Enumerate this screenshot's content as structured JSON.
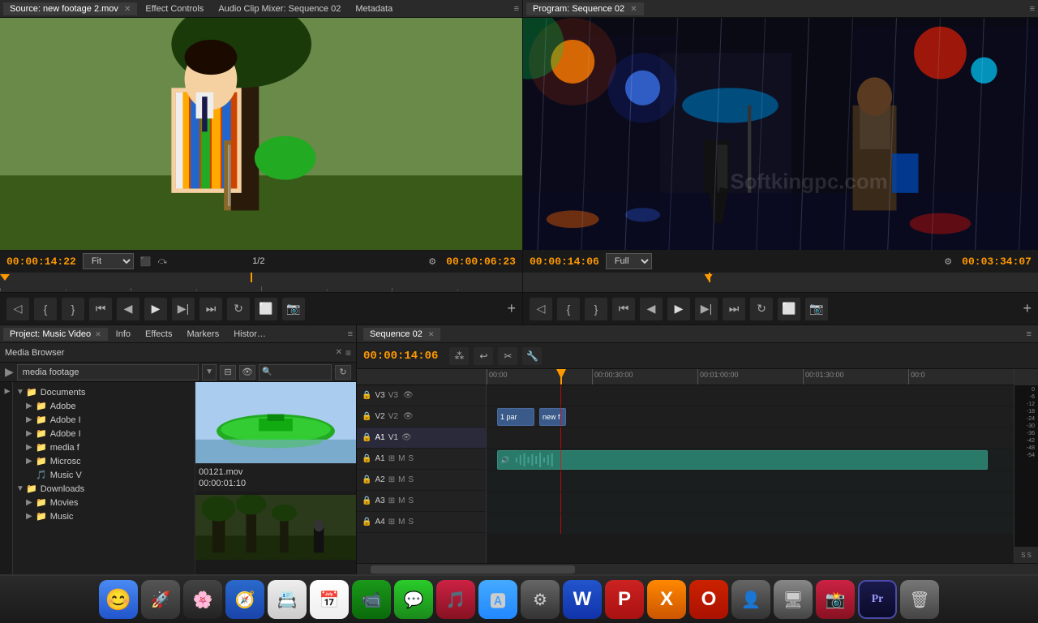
{
  "app": {
    "title": "Adobe Premiere Pro"
  },
  "source_panel": {
    "tabs": [
      {
        "label": "Source: new footage 2.mov",
        "active": true,
        "closeable": true
      },
      {
        "label": "Effect Controls",
        "active": false
      },
      {
        "label": "Audio Clip Mixer: Sequence 02",
        "active": false
      },
      {
        "label": "Metadata",
        "active": false
      }
    ],
    "timecode": "00:00:14:22",
    "fit_label": "Fit",
    "fraction": "1/2",
    "duration": "00:00:06:23"
  },
  "program_panel": {
    "tabs": [
      {
        "label": "Program: Sequence 02",
        "active": true,
        "closeable": true
      }
    ],
    "timecode": "00:00:14:06",
    "fit_label": "Full",
    "duration": "00:03:34:07"
  },
  "project_panel": {
    "tabs": [
      {
        "label": "Project: Music Video",
        "active": true,
        "closeable": true
      },
      {
        "label": "Info",
        "active": false
      },
      {
        "label": "Effects",
        "active": false
      },
      {
        "label": "Markers",
        "active": false
      },
      {
        "label": "History",
        "active": false
      }
    ]
  },
  "media_browser": {
    "label": "Media Browser",
    "path": "media footage",
    "tree_items": [
      {
        "label": "Documents",
        "icon": "folder",
        "depth": 0,
        "expanded": true
      },
      {
        "label": "Adobe",
        "icon": "folder",
        "depth": 1
      },
      {
        "label": "Adobe I",
        "icon": "folder",
        "depth": 1
      },
      {
        "label": "Adobe I",
        "icon": "folder",
        "depth": 1
      },
      {
        "label": "media f",
        "icon": "folder",
        "depth": 1
      },
      {
        "label": "Microsc",
        "icon": "folder",
        "depth": 1
      },
      {
        "label": "Music V",
        "icon": "music",
        "depth": 1
      },
      {
        "label": "Downloads",
        "icon": "folder",
        "depth": 0,
        "expanded": true
      },
      {
        "label": "Movies",
        "icon": "folder",
        "depth": 1
      },
      {
        "label": "Music",
        "icon": "folder",
        "depth": 1
      }
    ],
    "preview": {
      "filename": "00121.mov",
      "duration": "00:00:01:10"
    }
  },
  "timeline": {
    "sequence_tab": "Sequence 02",
    "timecode": "00:00:14:06",
    "ruler_marks": [
      "00:00",
      "00:00:30:00",
      "00:01:00:00",
      "00:01:30:00",
      "00:0"
    ],
    "tracks": [
      {
        "name": "V3",
        "type": "video"
      },
      {
        "name": "V2",
        "type": "video",
        "clips": [
          {
            "label": "1 par",
            "start": 2,
            "width": 8
          },
          {
            "label": "new f",
            "start": 10,
            "width": 6
          }
        ]
      },
      {
        "name": "V1",
        "type": "video"
      },
      {
        "name": "A1",
        "type": "audio",
        "clips": [
          {
            "label": "",
            "start": 2,
            "width": 190
          }
        ]
      },
      {
        "name": "A2",
        "type": "audio"
      },
      {
        "name": "A3",
        "type": "audio"
      },
      {
        "name": "A4",
        "type": "audio"
      }
    ],
    "playhead_position": "14%",
    "buttons": {
      "snap": "⁂",
      "ripple": "⟳",
      "razor": "✂",
      "wrench": "🔧"
    }
  },
  "dock": {
    "icons": [
      {
        "name": "finder",
        "emoji": "😊",
        "color": "#4a8af4"
      },
      {
        "name": "launchpad",
        "emoji": "🚀",
        "color": "#555"
      },
      {
        "name": "photos",
        "emoji": "🖼",
        "color": "#888"
      },
      {
        "name": "safari",
        "emoji": "🧭",
        "color": "#555"
      },
      {
        "name": "contacts",
        "emoji": "📇",
        "color": "#555"
      },
      {
        "name": "calendar",
        "emoji": "📅",
        "color": "#f44"
      },
      {
        "name": "facetime",
        "emoji": "📹",
        "color": "#2a2"
      },
      {
        "name": "messages",
        "emoji": "💬",
        "color": "#2a2"
      },
      {
        "name": "music",
        "emoji": "🎵",
        "color": "#f55"
      },
      {
        "name": "appstore",
        "emoji": "🅰",
        "color": "#4af"
      },
      {
        "name": "activity",
        "emoji": "⚙",
        "color": "#888"
      },
      {
        "name": "word",
        "emoji": "W",
        "color": "#2255cc"
      },
      {
        "name": "powerpoint",
        "emoji": "P",
        "color": "#cc2222"
      },
      {
        "name": "xmind",
        "emoji": "X",
        "color": "#ff6600"
      },
      {
        "name": "opera",
        "emoji": "O",
        "color": "#cc0000"
      },
      {
        "name": "accounts",
        "emoji": "👤",
        "color": "#888"
      },
      {
        "name": "remote-desktop",
        "emoji": "🖥",
        "color": "#888"
      },
      {
        "name": "photobooth",
        "emoji": "📸",
        "color": "#888"
      },
      {
        "name": "premiere",
        "emoji": "Pr",
        "color": "#1a1a4a"
      },
      {
        "name": "trash",
        "emoji": "🗑",
        "color": "#555"
      }
    ]
  },
  "labels": {
    "media_browser_tab": "Media Browser",
    "media_footage_path": "media footage",
    "downloads": "Downloads",
    "effect_controls": "Effect Controls",
    "fit": "Fit",
    "full": "Full",
    "sequence_02": "Sequence 02",
    "v1": "V1",
    "v2": "V2",
    "v3": "V3",
    "a1": "A1",
    "a2": "A2",
    "a3": "A3",
    "a4": "A4",
    "filename": "00121.mov",
    "duration_short": "00:00:01:10",
    "softkingpc": "Softkingpc.com"
  }
}
